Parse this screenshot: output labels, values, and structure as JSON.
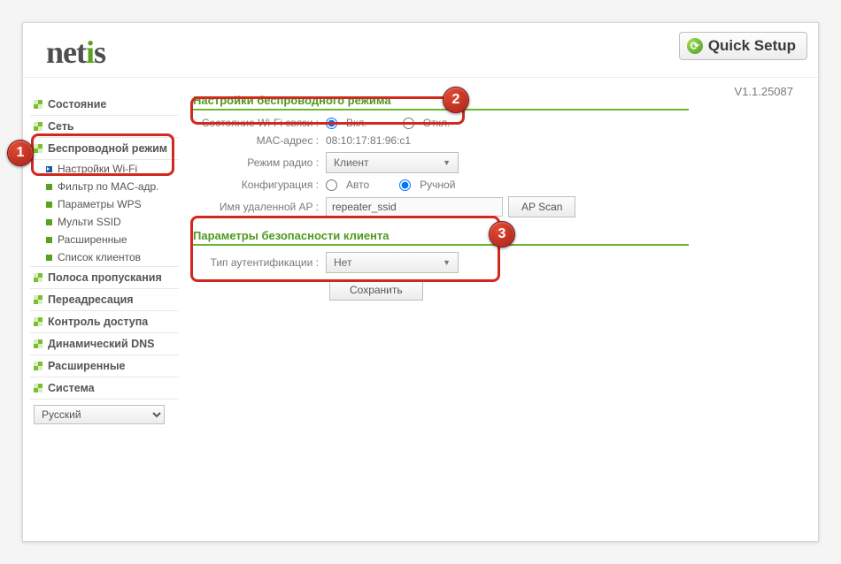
{
  "header": {
    "logo_text": "netis",
    "quick_setup": "Quick Setup"
  },
  "version": "V1.1.25087",
  "sidebar": {
    "items": [
      {
        "label": "Состояние"
      },
      {
        "label": "Сеть"
      },
      {
        "label": "Беспроводной режим"
      },
      {
        "label": "Полоса пропускания"
      },
      {
        "label": "Переадресация"
      },
      {
        "label": "Контроль доступа"
      },
      {
        "label": "Динамический DNS"
      },
      {
        "label": "Расширенные"
      },
      {
        "label": "Система"
      }
    ],
    "sub_items": [
      {
        "label": "Настройки Wi-Fi",
        "active": true
      },
      {
        "label": "Фильтр по MAC-адр."
      },
      {
        "label": "Параметры WPS"
      },
      {
        "label": "Мульти SSID"
      },
      {
        "label": "Расширенные"
      },
      {
        "label": "Список клиентов"
      }
    ],
    "language": "Русский"
  },
  "wireless": {
    "section_title": "Настройки беспроводного режима",
    "status_label": "Состояние Wi-Fi связи :",
    "status_on": "Вкл.",
    "status_off": "Откл.",
    "mac_label": "MAC-адрес :",
    "mac_value": "08:10:17:81:96:c1",
    "radio_label": "Режим радио :",
    "radio_value": "Клиент",
    "config_label": "Конфигурация :",
    "config_auto": "Авто",
    "config_manual": "Ручной",
    "remote_label": "Имя удаленной AP :",
    "remote_value": "repeater_ssid",
    "ap_scan": "AP Scan"
  },
  "security": {
    "section_title": "Параметры безопасности клиента",
    "auth_label": "Тип аутентификации :",
    "auth_value": "Нет",
    "save": "Сохранить"
  },
  "annotations": {
    "m1": "1",
    "m2": "2",
    "m3": "3"
  }
}
